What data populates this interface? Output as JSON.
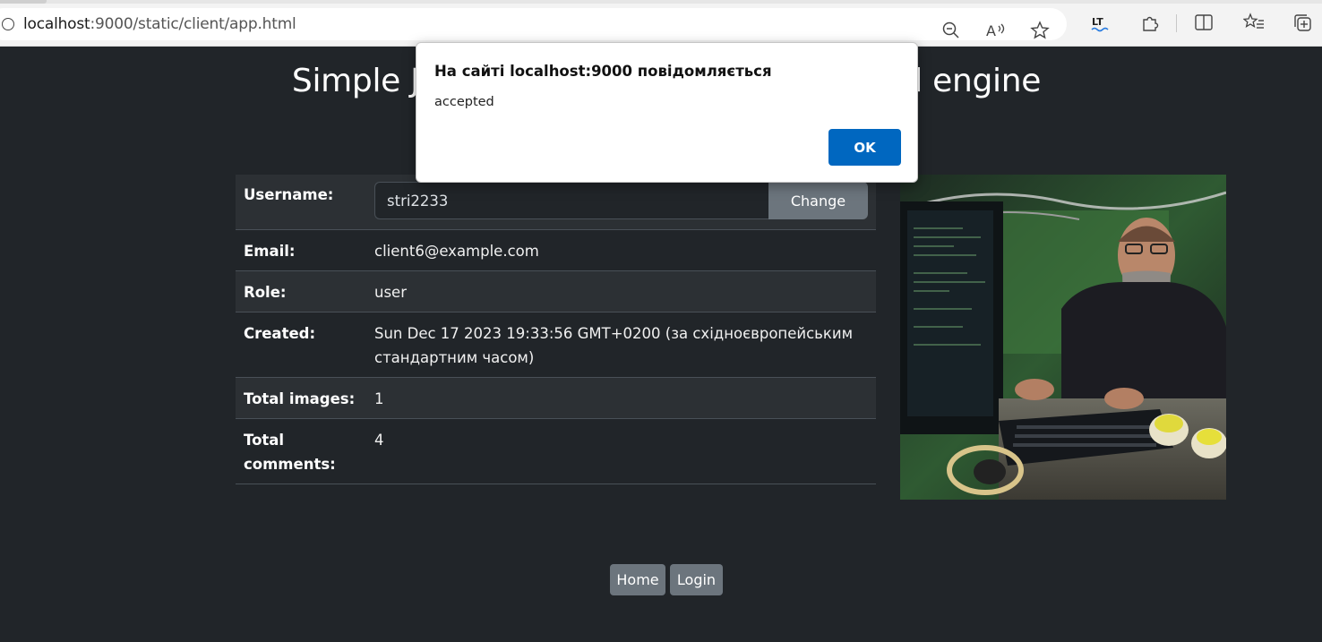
{
  "browser": {
    "url_host": "localhost",
    "url_rest": ":9000/static/client/app.html",
    "icons": [
      "zoom-out-icon",
      "read-aloud-icon",
      "favorite-star-icon",
      "languagetool-icon",
      "extensions-icon",
      "split-screen-icon",
      "favorites-list-icon",
      "collections-icon"
    ]
  },
  "page": {
    "title": "Simple Javascript client for the backend engine"
  },
  "profile": {
    "username_label": "Username:",
    "username_value": "stri2233",
    "change_label": "Change",
    "email_label": "Email:",
    "email_value": "client6@example.com",
    "role_label": "Role:",
    "role_value": "user",
    "created_label": "Created:",
    "created_value": "Sun Dec 17 2023 19:33:56 GMT+0200 (за східноєвропейським стандартним часом)",
    "images_label": "Total images:",
    "images_value": "1",
    "comments_label": "Total comments:",
    "comments_value": "4"
  },
  "nav": {
    "home_label": "Home",
    "login_label": "Login"
  },
  "alert": {
    "title": "На сайті localhost:9000 повідомляється",
    "message": "accepted",
    "ok_label": "OK"
  },
  "colors": {
    "page_bg": "#212529",
    "secondary_button": "#6c757d",
    "dialog_accent": "#0067c0"
  }
}
